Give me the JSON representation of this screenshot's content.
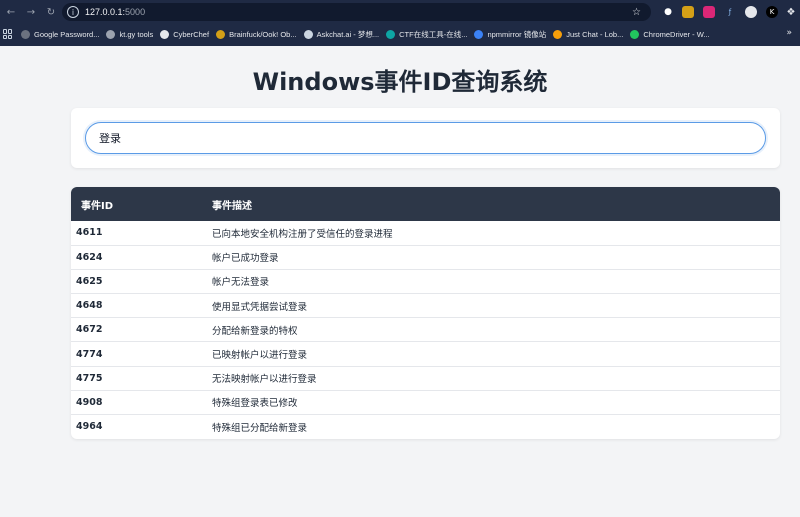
{
  "browser": {
    "url_host": "127.0.0.1:",
    "url_port": "5000",
    "bookmarks": [
      {
        "label": "Google Password...",
        "color": "#6b7280"
      },
      {
        "label": "kt.gy tools",
        "color": "#9ca3af"
      },
      {
        "label": "CyberChef",
        "color": "#e5e7eb"
      },
      {
        "label": "Brainfuck/Ook! Ob...",
        "color": "#d4a017"
      },
      {
        "label": "Askchat.ai - 梦想...",
        "color": "#cbd5e1"
      },
      {
        "label": "CTF在线工具-在线...",
        "color": "#0ea5a4"
      },
      {
        "label": "npmmirror 镜像站",
        "color": "#3b82f6"
      },
      {
        "label": "Just Chat - Lob...",
        "color": "#f59e0b"
      },
      {
        "label": "ChromeDriver - W...",
        "color": "#22c55e"
      }
    ]
  },
  "page": {
    "title": "Windows事件ID查询系统"
  },
  "search": {
    "value": "登录"
  },
  "table": {
    "headers": {
      "id": "事件ID",
      "desc": "事件描述"
    },
    "rows": [
      {
        "id": "4611",
        "desc": "已向本地安全机构注册了受信任的登录进程"
      },
      {
        "id": "4624",
        "desc": "帐户已成功登录"
      },
      {
        "id": "4625",
        "desc": "帐户无法登录"
      },
      {
        "id": "4648",
        "desc": "使用显式凭据尝试登录"
      },
      {
        "id": "4672",
        "desc": "分配给新登录的特权"
      },
      {
        "id": "4774",
        "desc": "已映射帐户以进行登录"
      },
      {
        "id": "4775",
        "desc": "无法映射帐户以进行登录"
      },
      {
        "id": "4908",
        "desc": "特殊组登录表已修改"
      },
      {
        "id": "4964",
        "desc": "特殊组已分配给新登录"
      }
    ]
  }
}
